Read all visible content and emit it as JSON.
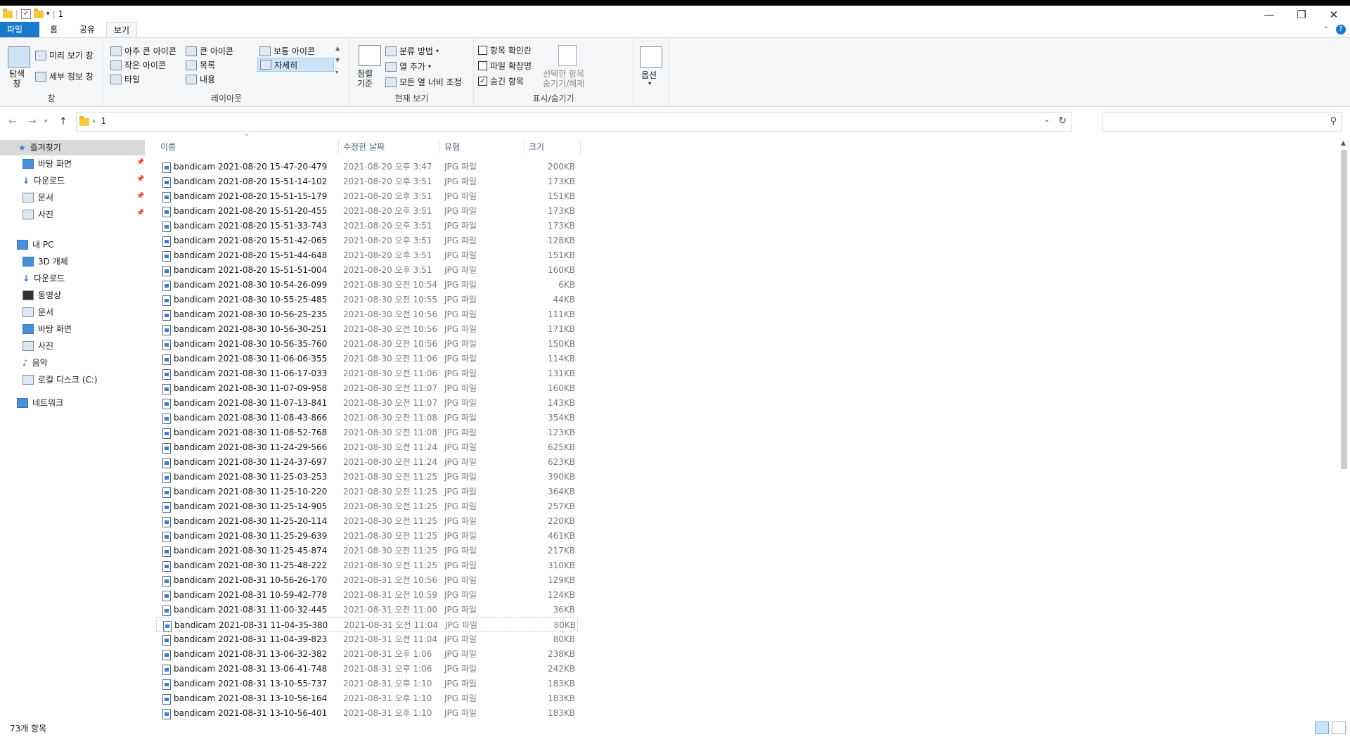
{
  "window": {
    "title": "1",
    "controls": [
      "minimize-icon",
      "restore-icon",
      "close-icon"
    ]
  },
  "tabs": [
    "파일",
    "홈",
    "공유",
    "보기"
  ],
  "ribbon": {
    "pane_group": {
      "label": "창",
      "nav_pane": "탐색\n창",
      "preview_pane": "미리 보기 창",
      "details_pane": "세부 정보 창"
    },
    "layout_group": {
      "label": "레이아웃",
      "items": [
        "아주 큰 아이콘",
        "큰 아이콘",
        "보통 아이콘",
        "작은 아이콘",
        "목록",
        "자세히",
        "타일",
        "내용"
      ],
      "selected": "자세히"
    },
    "current_view_group": {
      "label": "현재 보기",
      "sort_by": "정렬\n기준",
      "group_by": "분류 방법",
      "add_columns": "열 추가",
      "size_columns": "모든 열 너비 조정"
    },
    "show_hide_group": {
      "label": "표시/숨기기",
      "item_checkboxes": "항목 확인란",
      "item_checkboxes_checked": false,
      "file_extensions": "파일 확장명",
      "file_extensions_checked": false,
      "hidden_items": "숨긴 항목",
      "hidden_items_checked": true,
      "hide_selected": "선택한 항목\n숨기기/해제"
    },
    "options": "옵션"
  },
  "address": {
    "path": "1",
    "search_placeholder": ""
  },
  "nav_pane": {
    "quick_access": "즐겨찾기",
    "quick_items": [
      "바탕 화면",
      "다운로드",
      "문서",
      "사진"
    ],
    "this_pc": "내 PC",
    "pc_items": [
      "3D 개체",
      "다운로드",
      "동영상",
      "문서",
      "바탕 화면",
      "사진",
      "음악",
      "로컬 디스크 (C:)"
    ],
    "network": "네트워크"
  },
  "columns": {
    "name": "이름",
    "date": "수정한 날짜",
    "type": "유형",
    "size": "크기"
  },
  "files": [
    {
      "name": "bandicam 2021-08-20 15-47-20-479",
      "date": "2021-08-20 오후 3:47",
      "type": "JPG 파일",
      "size": "200KB"
    },
    {
      "name": "bandicam 2021-08-20 15-51-14-102",
      "date": "2021-08-20 오후 3:51",
      "type": "JPG 파일",
      "size": "173KB"
    },
    {
      "name": "bandicam 2021-08-20 15-51-15-179",
      "date": "2021-08-20 오후 3:51",
      "type": "JPG 파일",
      "size": "151KB"
    },
    {
      "name": "bandicam 2021-08-20 15-51-20-455",
      "date": "2021-08-20 오후 3:51",
      "type": "JPG 파일",
      "size": "173KB"
    },
    {
      "name": "bandicam 2021-08-20 15-51-33-743",
      "date": "2021-08-20 오후 3:51",
      "type": "JPG 파일",
      "size": "173KB"
    },
    {
      "name": "bandicam 2021-08-20 15-51-42-065",
      "date": "2021-08-20 오후 3:51",
      "type": "JPG 파일",
      "size": "128KB"
    },
    {
      "name": "bandicam 2021-08-20 15-51-44-648",
      "date": "2021-08-20 오후 3:51",
      "type": "JPG 파일",
      "size": "151KB"
    },
    {
      "name": "bandicam 2021-08-20 15-51-51-004",
      "date": "2021-08-20 오후 3:51",
      "type": "JPG 파일",
      "size": "160KB"
    },
    {
      "name": "bandicam 2021-08-30 10-54-26-099",
      "date": "2021-08-30 오전 10:54",
      "type": "JPG 파일",
      "size": "6KB"
    },
    {
      "name": "bandicam 2021-08-30 10-55-25-485",
      "date": "2021-08-30 오전 10:55",
      "type": "JPG 파일",
      "size": "44KB"
    },
    {
      "name": "bandicam 2021-08-30 10-56-25-235",
      "date": "2021-08-30 오전 10:56",
      "type": "JPG 파일",
      "size": "111KB"
    },
    {
      "name": "bandicam 2021-08-30 10-56-30-251",
      "date": "2021-08-30 오전 10:56",
      "type": "JPG 파일",
      "size": "171KB"
    },
    {
      "name": "bandicam 2021-08-30 10-56-35-760",
      "date": "2021-08-30 오전 10:56",
      "type": "JPG 파일",
      "size": "150KB"
    },
    {
      "name": "bandicam 2021-08-30 11-06-06-355",
      "date": "2021-08-30 오전 11:06",
      "type": "JPG 파일",
      "size": "114KB"
    },
    {
      "name": "bandicam 2021-08-30 11-06-17-033",
      "date": "2021-08-30 오전 11:06",
      "type": "JPG 파일",
      "size": "131KB"
    },
    {
      "name": "bandicam 2021-08-30 11-07-09-958",
      "date": "2021-08-30 오전 11:07",
      "type": "JPG 파일",
      "size": "160KB"
    },
    {
      "name": "bandicam 2021-08-30 11-07-13-841",
      "date": "2021-08-30 오전 11:07",
      "type": "JPG 파일",
      "size": "143KB"
    },
    {
      "name": "bandicam 2021-08-30 11-08-43-866",
      "date": "2021-08-30 오전 11:08",
      "type": "JPG 파일",
      "size": "354KB"
    },
    {
      "name": "bandicam 2021-08-30 11-08-52-768",
      "date": "2021-08-30 오전 11:08",
      "type": "JPG 파일",
      "size": "123KB"
    },
    {
      "name": "bandicam 2021-08-30 11-24-29-566",
      "date": "2021-08-30 오전 11:24",
      "type": "JPG 파일",
      "size": "625KB"
    },
    {
      "name": "bandicam 2021-08-30 11-24-37-697",
      "date": "2021-08-30 오전 11:24",
      "type": "JPG 파일",
      "size": "623KB"
    },
    {
      "name": "bandicam 2021-08-30 11-25-03-253",
      "date": "2021-08-30 오전 11:25",
      "type": "JPG 파일",
      "size": "390KB"
    },
    {
      "name": "bandicam 2021-08-30 11-25-10-220",
      "date": "2021-08-30 오전 11:25",
      "type": "JPG 파일",
      "size": "364KB"
    },
    {
      "name": "bandicam 2021-08-30 11-25-14-905",
      "date": "2021-08-30 오전 11:25",
      "type": "JPG 파일",
      "size": "257KB"
    },
    {
      "name": "bandicam 2021-08-30 11-25-20-114",
      "date": "2021-08-30 오전 11:25",
      "type": "JPG 파일",
      "size": "220KB"
    },
    {
      "name": "bandicam 2021-08-30 11-25-29-639",
      "date": "2021-08-30 오전 11:25",
      "type": "JPG 파일",
      "size": "461KB"
    },
    {
      "name": "bandicam 2021-08-30 11-25-45-874",
      "date": "2021-08-30 오전 11:25",
      "type": "JPG 파일",
      "size": "217KB"
    },
    {
      "name": "bandicam 2021-08-30 11-25-48-222",
      "date": "2021-08-30 오전 11:25",
      "type": "JPG 파일",
      "size": "310KB"
    },
    {
      "name": "bandicam 2021-08-31 10-56-26-170",
      "date": "2021-08-31 오전 10:56",
      "type": "JPG 파일",
      "size": "129KB"
    },
    {
      "name": "bandicam 2021-08-31 10-59-42-778",
      "date": "2021-08-31 오전 10:59",
      "type": "JPG 파일",
      "size": "124KB"
    },
    {
      "name": "bandicam 2021-08-31 11-00-32-445",
      "date": "2021-08-31 오전 11:00",
      "type": "JPG 파일",
      "size": "36KB"
    },
    {
      "name": "bandicam 2021-08-31 11-04-35-380",
      "date": "2021-08-31 오전 11:04",
      "type": "JPG 파일",
      "size": "80KB",
      "focused": true
    },
    {
      "name": "bandicam 2021-08-31 11-04-39-823",
      "date": "2021-08-31 오전 11:04",
      "type": "JPG 파일",
      "size": "80KB"
    },
    {
      "name": "bandicam 2021-08-31 13-06-32-382",
      "date": "2021-08-31 오후 1:06",
      "type": "JPG 파일",
      "size": "238KB"
    },
    {
      "name": "bandicam 2021-08-31 13-06-41-748",
      "date": "2021-08-31 오후 1:06",
      "type": "JPG 파일",
      "size": "242KB"
    },
    {
      "name": "bandicam 2021-08-31 13-10-55-737",
      "date": "2021-08-31 오후 1:10",
      "type": "JPG 파일",
      "size": "183KB"
    },
    {
      "name": "bandicam 2021-08-31 13-10-56-164",
      "date": "2021-08-31 오후 1:10",
      "type": "JPG 파일",
      "size": "183KB"
    },
    {
      "name": "bandicam 2021-08-31 13-10-56-401",
      "date": "2021-08-31 오후 1:10",
      "type": "JPG 파일",
      "size": "183KB"
    }
  ],
  "status": {
    "item_count": "73개 항목"
  },
  "colors": {
    "accent": "#1979ca",
    "ribbon_bg": "#f5f6f7",
    "selection": "#cce4f7"
  }
}
